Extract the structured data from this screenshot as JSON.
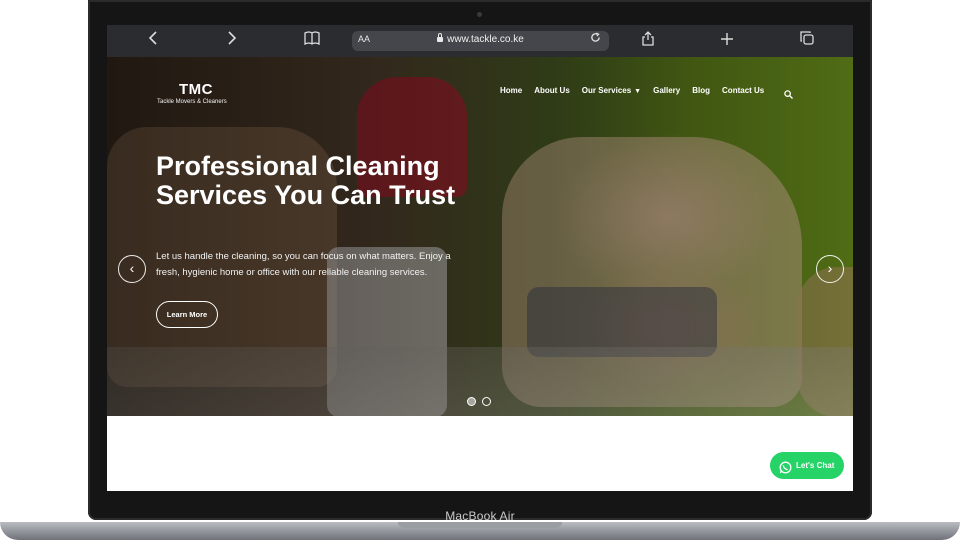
{
  "browser": {
    "text_size_label": "AA",
    "url": "www.tackle.co.ke"
  },
  "site": {
    "logo_mark": "TMC",
    "logo_text": "Tackle Movers & Cleaners",
    "nav": [
      "Home",
      "About Us",
      "Our Services",
      "Gallery",
      "Blog",
      "Contact Us"
    ]
  },
  "hero": {
    "headline": "Professional Cleaning Services You Can Trust",
    "subtext": "Let us handle the cleaning, so you can focus on what matters. Enjoy a fresh, hygienic home or office with our reliable cleaning services.",
    "cta": "Learn More",
    "active_slide": 1,
    "slide_count": 2
  },
  "chat": {
    "label": "Let's Chat"
  },
  "device": {
    "model": "MacBook Air"
  },
  "colors": {
    "accent_green": "#25d366",
    "toolbar": "#2b2c30"
  },
  "icons": [
    "back-icon",
    "forward-icon",
    "book-icon",
    "lock-icon",
    "reload-icon",
    "share-icon",
    "plus-icon",
    "tabs-icon",
    "search-icon",
    "whatsapp-icon",
    "chevron-left-icon",
    "chevron-right-icon",
    "chevron-down-icon"
  ]
}
